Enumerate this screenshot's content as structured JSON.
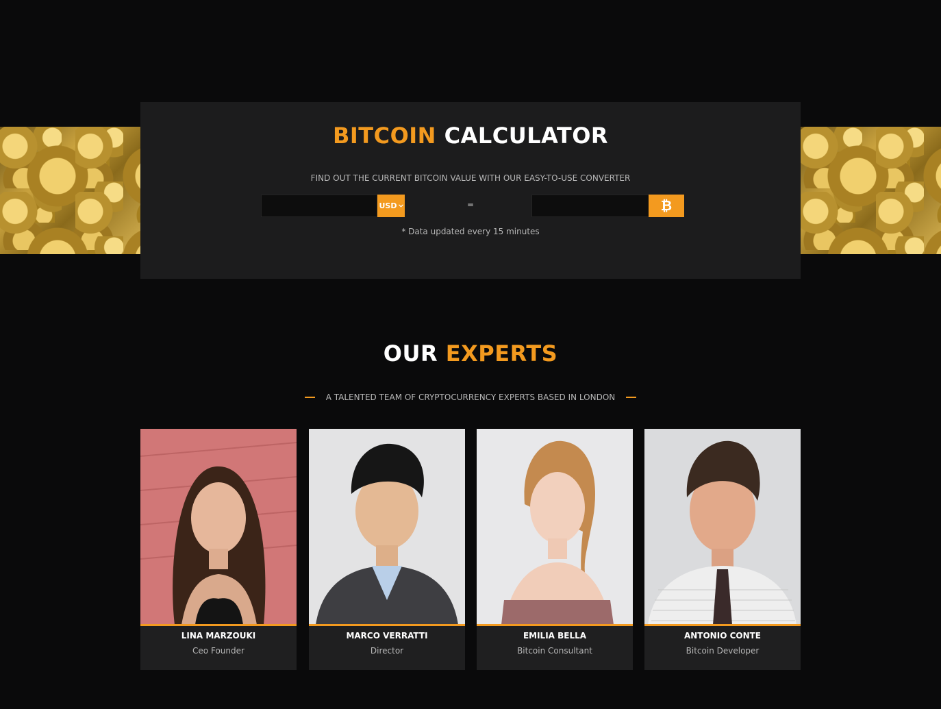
{
  "calculator": {
    "title_highlight": "BITCOIN",
    "title_rest": "CALCULATOR",
    "subtitle": "FIND OUT THE CURRENT BITCOIN VALUE WITH OUR EASY-TO-USE CONVERTER",
    "currency_value": "USD",
    "fiat_input_value": "",
    "btc_input_value": "",
    "equals_sign": "=",
    "btc_symbol": "₿",
    "note": "* Data updated every 15 minutes"
  },
  "experts": {
    "title_rest": "OUR",
    "title_highlight": "EXPERTS",
    "subtitle": "A TALENTED TEAM OF CRYPTOCURRENCY EXPERTS BASED IN LONDON",
    "members": [
      {
        "name": "LINA MARZOUKI",
        "role": "Ceo Founder"
      },
      {
        "name": "MARCO VERRATTI",
        "role": "Director"
      },
      {
        "name": "EMILIA BELLA",
        "role": "Bitcoin Consultant"
      },
      {
        "name": "ANTONIO CONTE",
        "role": "Bitcoin Developer"
      }
    ]
  },
  "colors": {
    "accent": "#f39a1f",
    "background": "#0a0a0b",
    "panel": "#1c1c1d"
  }
}
